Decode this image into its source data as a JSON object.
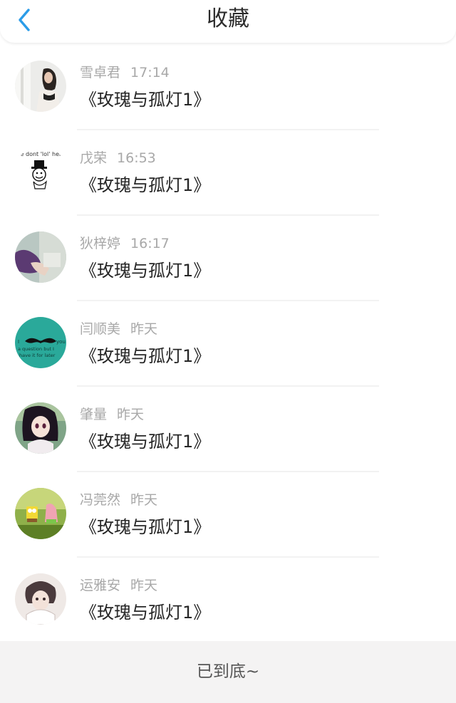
{
  "header": {
    "title": "收藏"
  },
  "favorites": [
    {
      "name": "雪卓君",
      "time": "17:14",
      "title": "《玫瑰与孤灯1》"
    },
    {
      "name": "戊荣",
      "time": "16:53",
      "title": "《玫瑰与孤灯1》",
      "avatar_text": "we dont 'lol' here"
    },
    {
      "name": "狄梓婷",
      "time": "16:17",
      "title": "《玫瑰与孤灯1》"
    },
    {
      "name": "闫顺美",
      "time": "昨天",
      "title": "《玫瑰与孤灯1》",
      "avatar_text": [
        "I",
        "you",
        "a question but I",
        "have it for later"
      ]
    },
    {
      "name": "肇量",
      "time": "昨天",
      "title": "《玫瑰与孤灯1》"
    },
    {
      "name": "冯莞然",
      "time": "昨天",
      "title": "《玫瑰与孤灯1》"
    },
    {
      "name": "运雅安",
      "time": "昨天",
      "title": "《玫瑰与孤灯1》"
    }
  ],
  "footer": {
    "end_text": "已到底~"
  },
  "colors": {
    "accent": "#2b9ce8",
    "teal_avatar": "#2aa99a"
  },
  "icons": {
    "back": "chevron-left-icon"
  }
}
